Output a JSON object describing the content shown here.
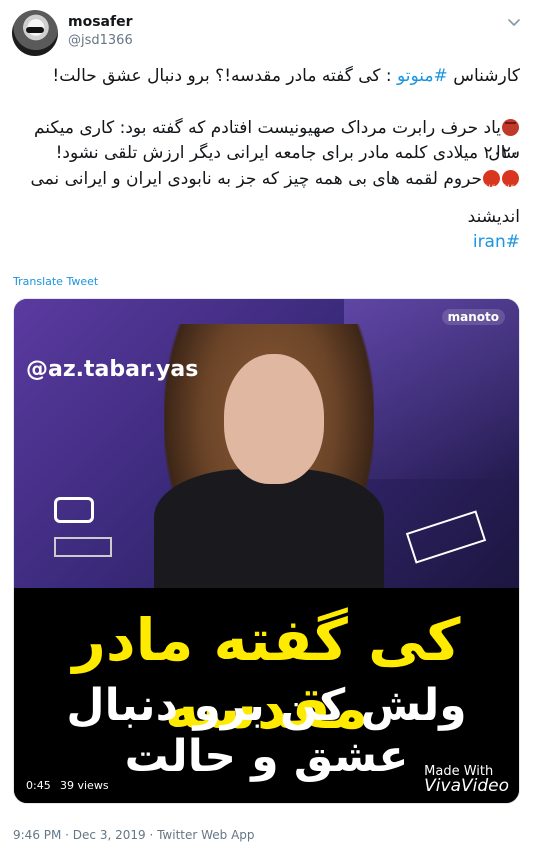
{
  "header": {
    "display_name": "mosafer",
    "handle": "@jsd1366"
  },
  "tweet": {
    "line1": "کارشناس #منوتو : کی گفته مادر مقدسه!؟ برو دنبال عشق حالت!",
    "para2_line1": "یاد حرف رابرت مرداک صهیونیست افتادم که گفته بود: کاری میکنم سال",
    "para2_line2": "۲۰۲۰ میلادی  کلمه مادر برای جامعه ایرانی دیگر ارزش تلقی نشود!",
    "para2_line3": "حروم لقمه های بی همه چیز که جز به نابودی ایران و ایرانی نمی",
    "para2_line4": "اندیشند",
    "hashtag_iran": "#iran",
    "hashtag_manoto": "#منوتو",
    "line1_before": "کارشناس",
    "line1_after": ": کی گفته مادر مقدسه!؟ برو دنبال عشق حالت!"
  },
  "translate_label": "Translate Tweet",
  "media": {
    "tv_logo": "manoto",
    "channel_handle": "@az.tabar.yas",
    "caption_line1": "کی گفته مادر مقدسه",
    "caption_line2": "ولش کن برو دنبال عشق و حالت",
    "watermark_line1": "Made With",
    "watermark_line2": "VivaVideo",
    "duration": "0:45",
    "views": "39 views"
  },
  "meta": {
    "timestamp": "9:46 PM · Dec 3, 2019 · Twitter Web App"
  },
  "colors": {
    "link": "#1b95e0",
    "text": "#14171a",
    "muted": "#657786",
    "caption_yellow": "#ffeb00"
  },
  "icons": [
    "avatar-image",
    "chevron-down-icon",
    "ogre-emoji",
    "cursing-face-emoji"
  ]
}
